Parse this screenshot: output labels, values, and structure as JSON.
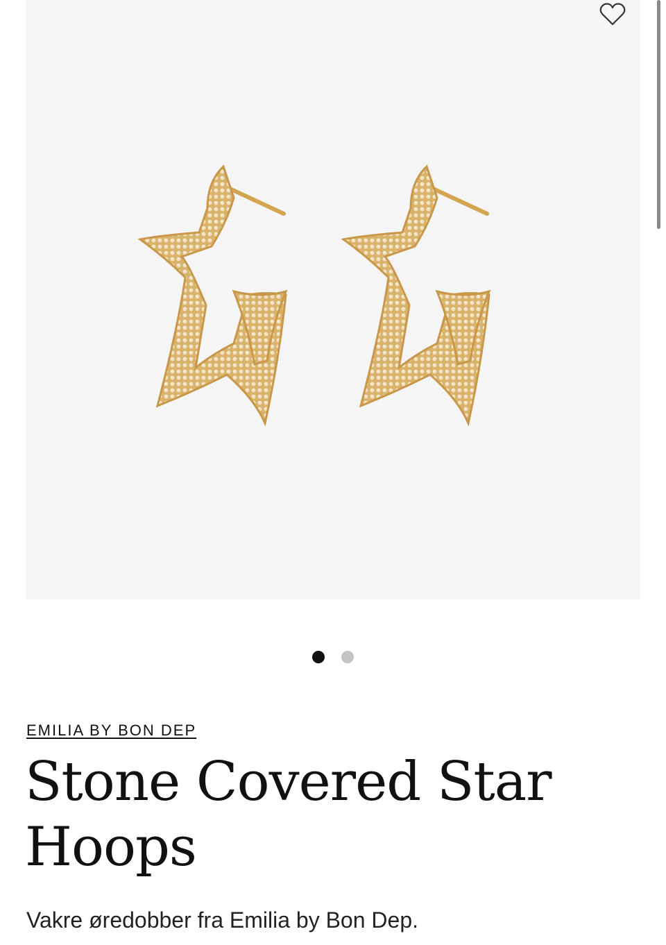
{
  "product": {
    "brand": "EMILIA BY BON DEP",
    "title": "Stone Covered Star Hoops",
    "description": "Vakre øredobber fra Emilia by Bon Dep.",
    "image_alt": "gold star hoop earrings"
  },
  "gallery": {
    "total_images": 2,
    "active_index": 0
  },
  "icons": {
    "wishlist": "heart-outline-icon"
  },
  "colors": {
    "image_background": "#f5f5f5",
    "gold": "#d9b36a",
    "dot_active": "#111111",
    "dot_inactive": "#c4c4c4"
  }
}
